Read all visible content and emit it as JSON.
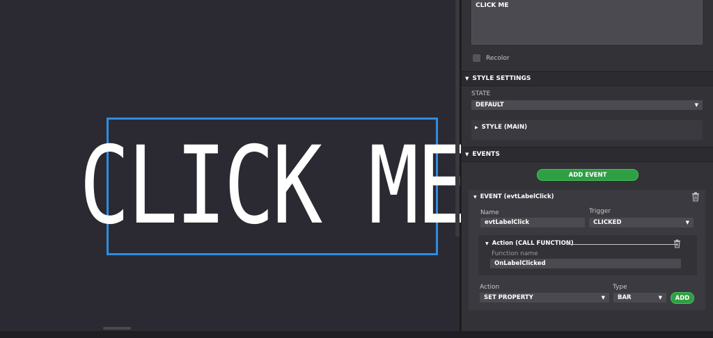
{
  "canvas": {
    "label_text": "CLICK ME"
  },
  "properties": {
    "text_value": "CLICK ME",
    "recolor_label": "Recolor",
    "style_settings": {
      "title": "STYLE SETTINGS",
      "state_label": "STATE",
      "state_value": "DEFAULT",
      "style_main_label": "STYLE (MAIN)"
    },
    "events": {
      "title": "EVENTS",
      "add_event_label": "ADD EVENT",
      "event_title": "EVENT (evtLabelClick)",
      "name_label": "Name",
      "name_value": "evtLabelClick",
      "trigger_label": "Trigger",
      "trigger_value": "CLICKED",
      "action_title": "Action (CALL FUNCTION)",
      "function_name_label": "Function name",
      "function_name_value": "OnLabelClicked",
      "action_label": "Action",
      "action_value": "SET PROPERTY",
      "type_label": "Type",
      "type_value": "BAR",
      "add_label": "ADD"
    }
  },
  "icons": [
    "triangle-down-icon",
    "triangle-right-icon",
    "trash-icon",
    "checkbox-icon",
    "chevron-down-icon"
  ],
  "colors": {
    "selection": "#2f8de0",
    "accent_green": "#2ea043",
    "canvas_bg": "#2b2a32",
    "panel_bg": "#333237"
  }
}
